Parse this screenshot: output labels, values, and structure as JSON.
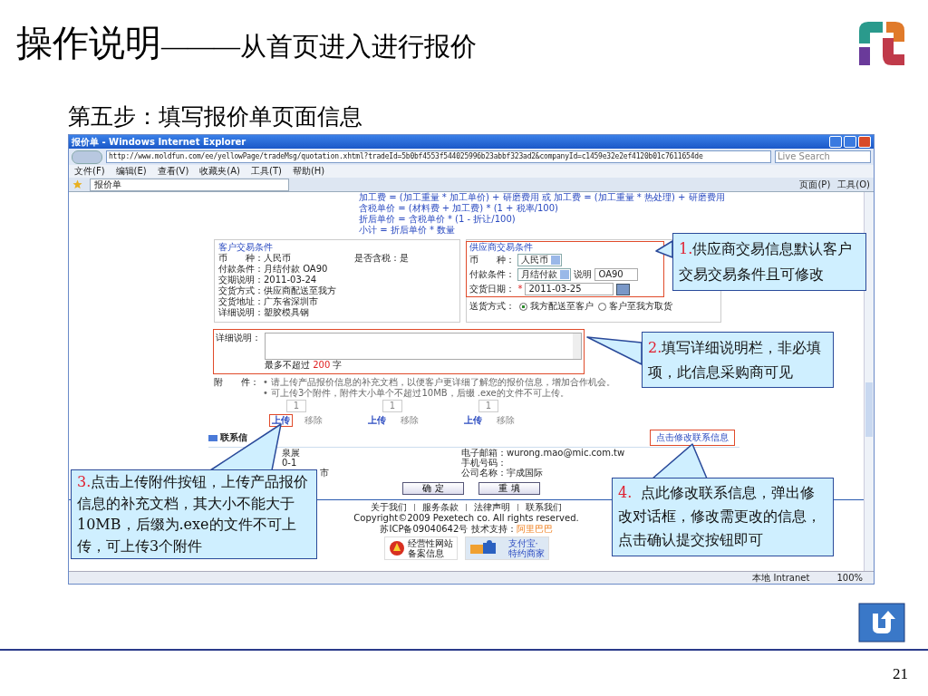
{
  "slide": {
    "title_main": "操作说明",
    "title_rest": "———从首页进入进行报价",
    "subtitle": "第五步：填写报价单页面信息",
    "page_number": "21"
  },
  "browser": {
    "title": "报价单 - Windows Internet Explorer",
    "url": "http://www.moldfun.com/ee/yellowPage/tradeMsg/quotation.xhtml?tradeId=5b0bf4553f544025996b23abbf323ad2&companyId=c1459e32e2ef4120b01c7611654de",
    "search_placeholder": "Live Search",
    "menu": [
      "文件(F)",
      "编辑(E)",
      "查看(V)",
      "收藏夹(A)",
      "工具(T)",
      "帮助(H)"
    ],
    "tab": "报价单",
    "toolbar_right": [
      "页面(P)",
      "工具(O)"
    ],
    "status_zone": "本地 Intranet",
    "zoom": "100%"
  },
  "formulas": [
    "加工费 = (加工重量 * 加工单价) + 研磨费用 或 加工费 = (加工重量 * 热处理) + 研磨费用",
    "含税单价 = (材料费 + 加工费) * (1 + 税率/100)",
    "折后单价 = 含税单价 * (1 - 折让/100)",
    "小计 = 折后单价 * 数量"
  ],
  "customer_terms": {
    "legend": "客户交易条件",
    "rows": [
      "币　　种：人民币",
      "付款条件：月结付款 OA90",
      "交期说明：2011-03-24",
      "交货方式：供应商配送至我方",
      "交货地址：广东省深圳市",
      "详细说明：塑胶模具钢"
    ],
    "tax": "是否含税：是"
  },
  "supplier_terms": {
    "legend": "供应商交易条件",
    "currency_label": "币　　种：",
    "currency": "人民币",
    "payment_label": "付款条件：",
    "payment": "月结付款",
    "note_label": "说明",
    "note": "OA90",
    "date_label": "交货日期：",
    "required_mark": "*",
    "date": "2011-03-25"
  },
  "delivery": {
    "label": "送货方式：",
    "options": [
      {
        "label": "我方配送至客户",
        "selected": true
      },
      {
        "label": "客户至我方取货",
        "selected": false
      }
    ]
  },
  "details": {
    "label": "详细说明：",
    "hint_before": "最多不超过",
    "limit": "200",
    "hint_after": "字"
  },
  "attachments": {
    "label": "附　　件：",
    "notes": [
      "• 请上传产品报价信息的补充文档，以便客户更详细了解您的报价信息，增加合作机会。",
      "• 可上传3个附件，附件大小单个不超过10MB，后缀 .exe的文件不可上传。"
    ],
    "slots": [
      {
        "placeholder": "1",
        "upload": "上传",
        "remove": "移除"
      },
      {
        "placeholder": "1",
        "upload": "上传",
        "remove": "移除"
      },
      {
        "placeholder": "1",
        "upload": "上传",
        "remove": "移除"
      }
    ]
  },
  "contact": {
    "header": "联系信",
    "modify_link": "点击修改联系信息",
    "left": [
      "泉展",
      "0-1",
      "市"
    ],
    "right": [
      "电子邮箱：wurong.mao@mic.com.tw",
      "手机号码：",
      "公司名称：宇成国际"
    ]
  },
  "buttons": [
    "确 定",
    "重 填"
  ],
  "footer": {
    "links": [
      "关于我们",
      "服务条款",
      "法律声明",
      "联系我们"
    ],
    "copyright": "Copyright©2009 Pexetech co. All rights reserved.",
    "icp": "苏ICP备09040642号 技术支持：",
    "icp_link": "阿里巴巴",
    "badges": [
      {
        "lines": [
          "经营性网站",
          "备案信息"
        ]
      },
      {
        "lines": [
          "支付宝·",
          "特约商家"
        ]
      }
    ]
  },
  "callouts": [
    {
      "num": "1.",
      "text": "供应商交易信息默认客户交易交易条件且可修改"
    },
    {
      "num": "2.",
      "text": "填写详细说明栏，非必填项，此信息采购商可见"
    },
    {
      "num": "3.",
      "text": "点击上传附件按钮，上传产品报价信息的补充文档，其大小不能大于10MB，后缀为.exe的文件不可上传，可上传3个附件"
    },
    {
      "num": "4.",
      "text": "  点此修改联系信息，弹出修改对话框，修改需更改的信息，点击确认提交按钮即可"
    }
  ]
}
